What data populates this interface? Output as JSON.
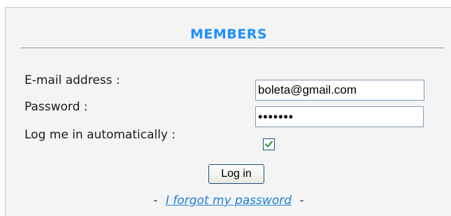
{
  "members_box": {
    "title": "MEMBERS",
    "email": {
      "label": "E-mail address :",
      "value": "boleta@gmail.com"
    },
    "password": {
      "label": "Password :",
      "value": "passwrd"
    },
    "auto_login": {
      "label": "Log me in automatically :",
      "checked": true
    },
    "login_button": "Log in",
    "forgot": {
      "dash_left": "-",
      "link_text": "I forgot my password",
      "dash_right": "-"
    }
  },
  "colors": {
    "title": "#1e90ff",
    "link": "#1e7fd6",
    "checkmark": "#2e9e3e",
    "panel_bg": "#f4f4f4",
    "input_border": "#7f9db9"
  }
}
